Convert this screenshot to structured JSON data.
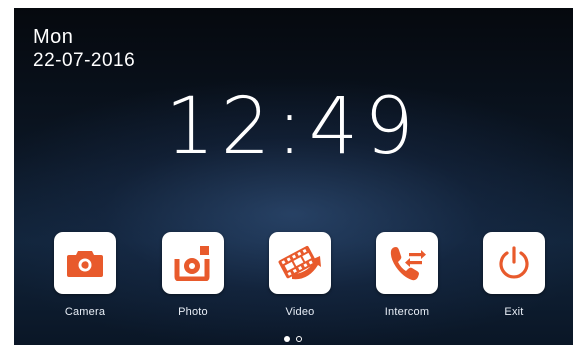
{
  "status": {
    "day": "Mon",
    "date": "22-07-2016",
    "time": "12:49"
  },
  "apps": [
    {
      "label": "Camera",
      "icon": "camera-icon"
    },
    {
      "label": "Photo",
      "icon": "photo-icon"
    },
    {
      "label": "Video",
      "icon": "video-film-icon"
    },
    {
      "label": "Intercom",
      "icon": "intercom-phone-icon"
    },
    {
      "label": "Exit",
      "icon": "power-icon"
    }
  ],
  "pager": {
    "current_page": 1,
    "total_pages": 2
  },
  "colors": {
    "accent": "#e85a2c",
    "tile": "#ffffff",
    "background": "#0b1624"
  }
}
